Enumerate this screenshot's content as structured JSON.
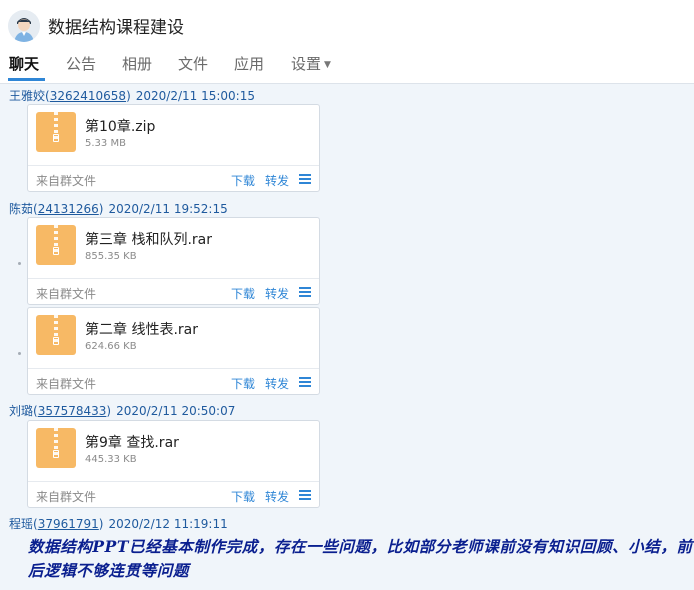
{
  "header": {
    "title": "数据结构课程建设",
    "tabs": [
      {
        "label": "聊天",
        "active": true
      },
      {
        "label": "公告",
        "active": false
      },
      {
        "label": "相册",
        "active": false
      },
      {
        "label": "文件",
        "active": false
      },
      {
        "label": "应用",
        "active": false
      },
      {
        "label": "设置",
        "active": false
      }
    ]
  },
  "messages": [
    {
      "name": "王雅姣",
      "qq": "3262410658",
      "time": "2020/2/11 15:00:15",
      "files": [
        {
          "name": "第10章.zip",
          "size": "5.33 MB"
        }
      ]
    },
    {
      "name": "陈茹",
      "qq": "24131266",
      "time": "2020/2/11 19:52:15",
      "files": [
        {
          "name": "第三章 栈和队列.rar",
          "size": "855.35 KB"
        },
        {
          "name": "第二章 线性表.rar",
          "size": "624.66 KB"
        }
      ]
    },
    {
      "name": "刘璐",
      "qq": "357578433",
      "time": "2020/2/11 20:50:07",
      "files": [
        {
          "name": "第9章 查找.rar",
          "size": "445.33 KB"
        }
      ]
    },
    {
      "name": "程瑶",
      "qq": "37961791",
      "time": "2020/2/12 11:19:11",
      "text": "数据结构PPT已经基本制作完成，存在一些问题，比如部分老师课前没有知识回顾、小结，前后逻辑不够连贯等问题"
    }
  ],
  "file_card": {
    "source": "来自群文件",
    "download": "下载",
    "forward": "转发"
  },
  "icons": {
    "file": "zip-archive-icon",
    "more": "menu-lines-icon",
    "settings_caret": "caret-down-icon"
  },
  "colors": {
    "accent": "#2f86d6",
    "sender": "#1f5a9e",
    "message_text": "#0a1f8f",
    "file_icon": "#f7b965",
    "background": "#f0f5fa"
  }
}
